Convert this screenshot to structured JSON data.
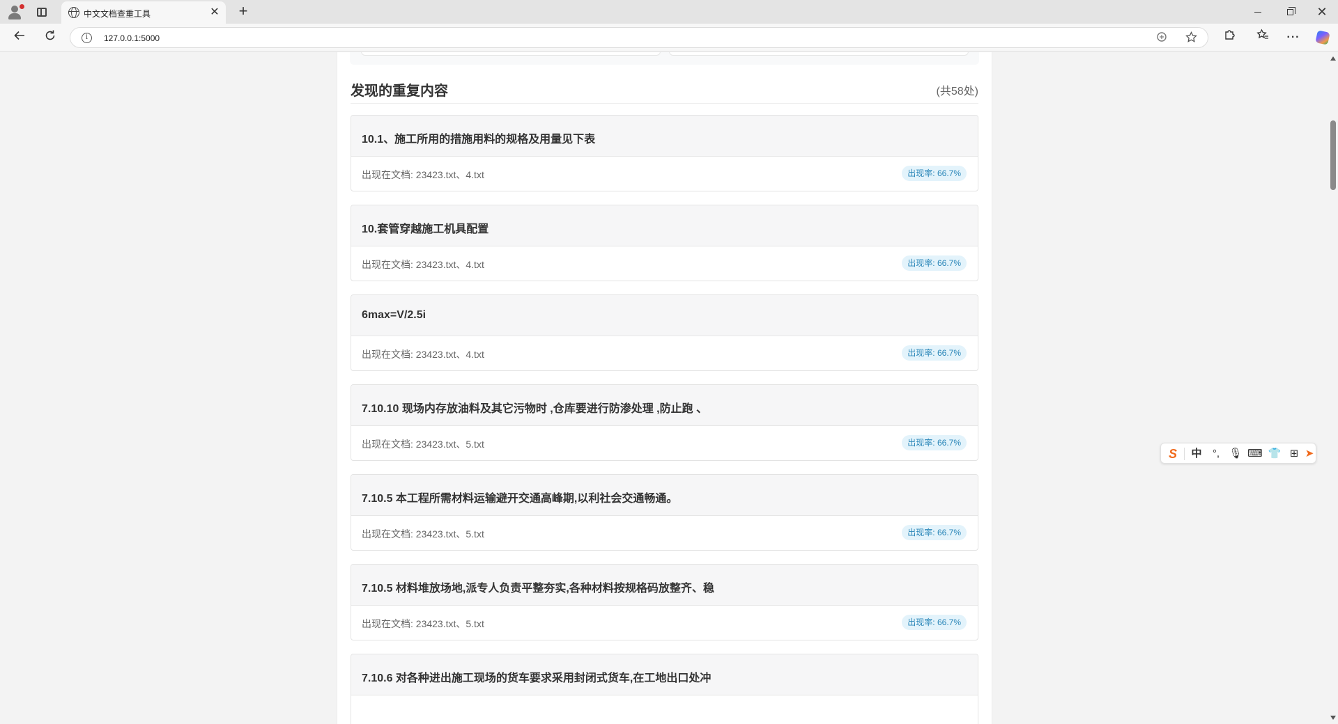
{
  "browser": {
    "tab_title": "中文文档查重工具",
    "tab_close": "✕",
    "new_tab": "+",
    "url": "127.0.0.1:5000",
    "info_icon_glyph": "i",
    "window_close": "✕"
  },
  "section": {
    "title": "发现的重复内容",
    "count": "(共58处)"
  },
  "results": [
    {
      "title": "10.1、施工所用的措施用料的规格及用量见下表",
      "docs": "出现在文档: 23423.txt、4.txt",
      "rate": "出现率: 66.7%"
    },
    {
      "title": "10.套管穿越施工机具配置",
      "docs": "出现在文档: 23423.txt、4.txt",
      "rate": "出现率: 66.7%"
    },
    {
      "title": "6max=V/2.5i",
      "docs": "出现在文档: 23423.txt、4.txt",
      "rate": "出现率: 66.7%"
    },
    {
      "title": "7.10.10 现场内存放油料及其它污物时 ,仓库要进行防渗处理 ,防止跑 、",
      "docs": "出现在文档: 23423.txt、5.txt",
      "rate": "出现率: 66.7%"
    },
    {
      "title": "7.10.5 本工程所需材料运输避开交通高峰期,以利社会交通畅通。",
      "docs": "出现在文档: 23423.txt、5.txt",
      "rate": "出现率: 66.7%"
    },
    {
      "title": "7.10.5 材料堆放场地,派专人负责平整夯实,各种材料按规格码放整齐、稳",
      "docs": "出现在文档: 23423.txt、5.txt",
      "rate": "出现率: 66.7%"
    },
    {
      "title": "7.10.6 对各种进出施工现场的货车要求采用封闭式货车,在工地出口处冲",
      "docs": "",
      "rate": ""
    }
  ],
  "ime": {
    "logo": "S",
    "mode": "中",
    "punct": "°,",
    "mic": "🎙",
    "keyboard": "⌨",
    "skin": "👕",
    "grid": "⊞",
    "extra": "➤"
  },
  "colors": {
    "rate_badge_bg": "#e3f3fb",
    "rate_badge_text": "#2a86b8",
    "ime_brand": "#f06a1c"
  }
}
